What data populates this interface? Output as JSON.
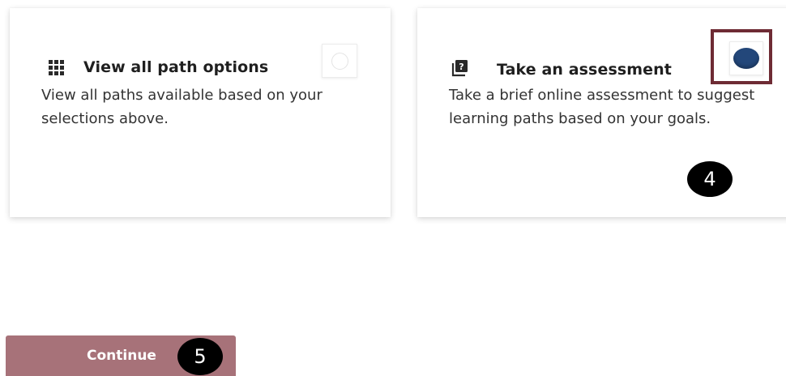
{
  "cards": [
    {
      "title": "View all path options",
      "icon": "grid-icon",
      "description": "View all paths available based on your selections above.",
      "selected": false
    },
    {
      "title": "Take an assessment",
      "icon": "question-stack-icon",
      "description": "Take a brief online assessment to suggest learning paths based on your goals.",
      "selected": true,
      "step_badge": "4"
    }
  ],
  "continue_button": {
    "label": "Continue",
    "step_badge": "5"
  },
  "colors": {
    "highlight_border": "#6e2b34",
    "radio_selected": "#23477a",
    "button_background": "#a77279",
    "badge_background": "#000000"
  }
}
